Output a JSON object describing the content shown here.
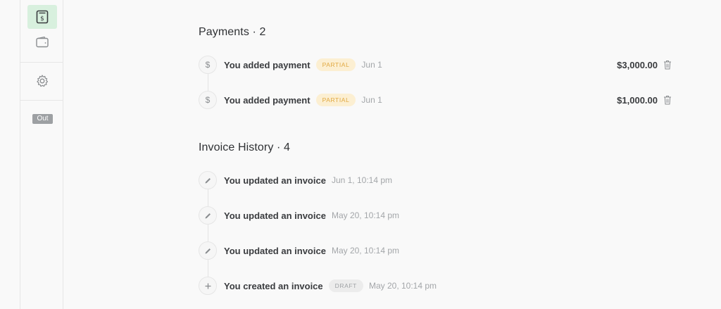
{
  "sidebar": {
    "items": [
      {
        "icon": "invoice-dollar-icon",
        "active": true
      },
      {
        "icon": "wallet-icon",
        "active": false
      },
      {
        "icon": "gear-icon",
        "active": false
      }
    ],
    "badge": "Out"
  },
  "payments": {
    "title": "Payments · 2",
    "items": [
      {
        "text": "You added payment",
        "status": "PARTIAL",
        "date": "Jun 1",
        "amount": "$3,000.00"
      },
      {
        "text": "You added payment",
        "status": "PARTIAL",
        "date": "Jun 1",
        "amount": "$1,000.00"
      }
    ]
  },
  "history": {
    "title": "Invoice History · 4",
    "items": [
      {
        "icon": "pencil-icon",
        "text": "You updated an invoice",
        "date": "Jun 1, 10:14 pm"
      },
      {
        "icon": "pencil-icon",
        "text": "You updated an invoice",
        "date": "May 20, 10:14 pm"
      },
      {
        "icon": "pencil-icon",
        "text": "You updated an invoice",
        "date": "May 20, 10:14 pm"
      },
      {
        "icon": "plus-icon",
        "text": "You created an invoice",
        "status": "DRAFT",
        "date": "May 20, 10:14 pm"
      }
    ]
  },
  "colors": {
    "accent_bg": "#d8f0de",
    "partial_bg": "#fcefd2",
    "partial_text": "#e0a840",
    "draft_bg": "#ececec",
    "draft_text": "#9fa2a5"
  }
}
